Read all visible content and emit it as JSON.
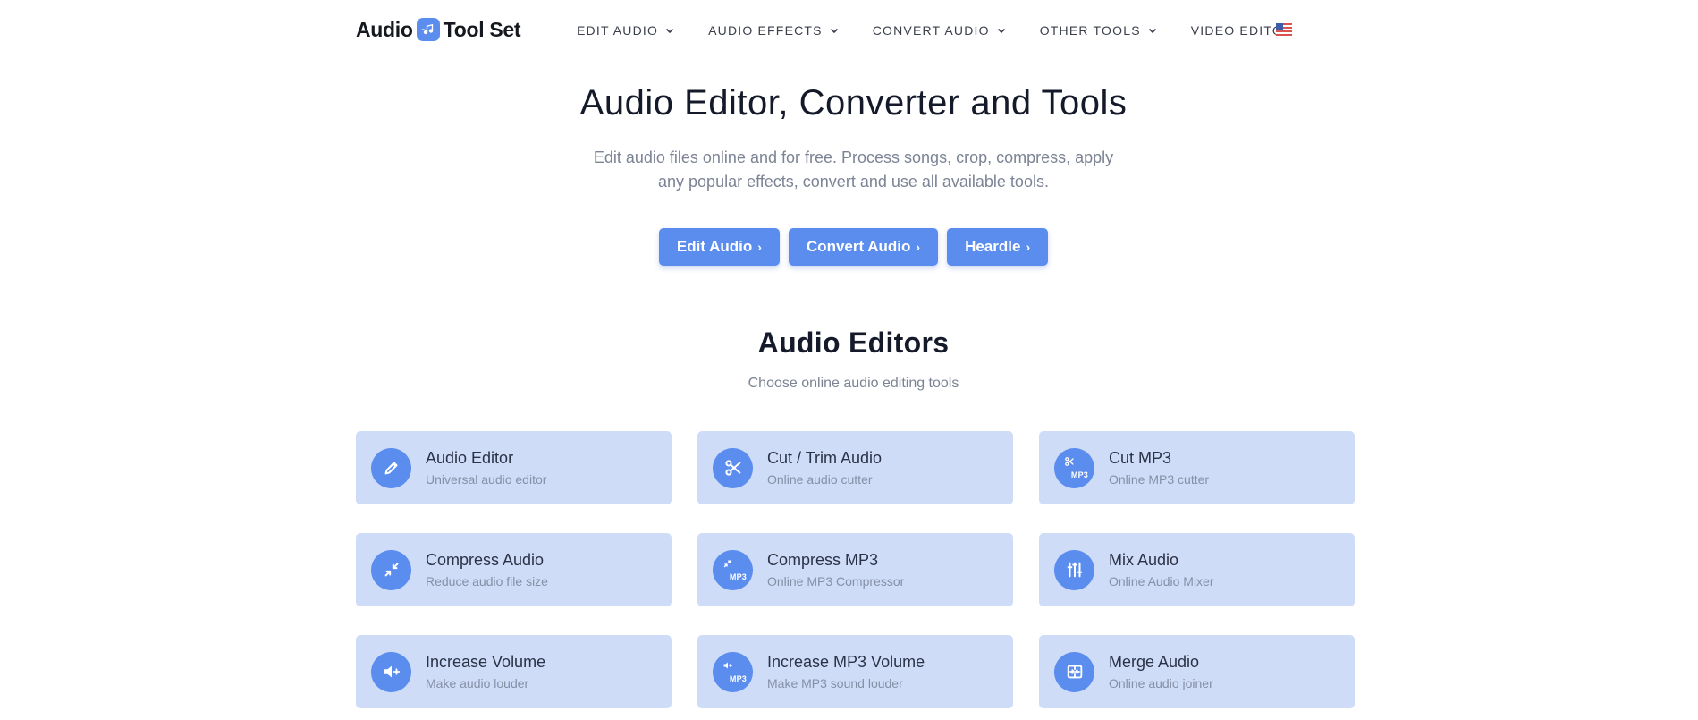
{
  "header": {
    "logo_left": "Audio",
    "logo_right": "Tool Set",
    "nav": [
      {
        "label": "EDIT AUDIO",
        "dropdown": true
      },
      {
        "label": "AUDIO EFFECTS",
        "dropdown": true
      },
      {
        "label": "CONVERT AUDIO",
        "dropdown": true
      },
      {
        "label": "OTHER TOOLS",
        "dropdown": true
      },
      {
        "label": "VIDEO EDITOR",
        "dropdown": false
      }
    ],
    "language_icon": "us-flag-icon"
  },
  "hero": {
    "title": "Audio Editor, Converter and Tools",
    "subtitle_line1": "Edit audio files online and for free. Process songs, crop, compress, apply",
    "subtitle_line2": "any popular effects, convert and use all available tools.",
    "buttons": [
      {
        "label": "Edit Audio",
        "arrow": "›"
      },
      {
        "label": "Convert Audio",
        "arrow": "›"
      },
      {
        "label": "Heardle",
        "arrow": "›"
      }
    ]
  },
  "section": {
    "title": "Audio Editors",
    "subtitle": "Choose online audio editing tools",
    "cards": [
      {
        "title": "Audio Editor",
        "desc": "Universal audio editor",
        "icon": "pencil-icon"
      },
      {
        "title": "Cut / Trim Audio",
        "desc": "Online audio cutter",
        "icon": "scissors-icon"
      },
      {
        "title": "Cut MP3",
        "desc": "Online MP3 cutter",
        "icon": "scissors-mp3-icon",
        "badge": "MP3"
      },
      {
        "title": "Compress Audio",
        "desc": "Reduce audio file size",
        "icon": "compress-icon"
      },
      {
        "title": "Compress MP3",
        "desc": "Online MP3 Compressor",
        "icon": "compress-mp3-icon",
        "badge": "MP3"
      },
      {
        "title": "Mix Audio",
        "desc": "Online Audio Mixer",
        "icon": "sliders-icon"
      },
      {
        "title": "Increase Volume",
        "desc": "Make audio louder",
        "icon": "volume-plus-icon"
      },
      {
        "title": "Increase MP3 Volume",
        "desc": "Make MP3 sound louder",
        "icon": "volume-plus-mp3-icon",
        "badge": "MP3"
      },
      {
        "title": "Merge Audio",
        "desc": "Online audio joiner",
        "icon": "merge-icon"
      }
    ]
  },
  "colors": {
    "accent": "#5b8def",
    "card_bg": "#cfdcf8",
    "muted_text": "#7b8394",
    "heading_text": "#141a2a"
  }
}
